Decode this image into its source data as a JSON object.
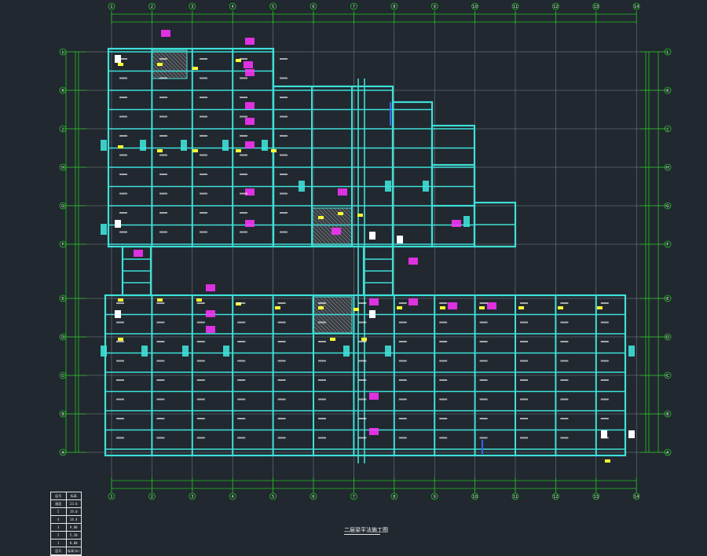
{
  "drawing": {
    "title": "二层梁平法施工图",
    "colors": {
      "background": "#212830",
      "grid_axis": "#22c41e",
      "beam": "#3ee0d8",
      "slab_label": "#ffffff",
      "annotation_magenta": "#ff33ff",
      "annotation_yellow": "#ffff33",
      "column": "#ffffff",
      "hatch": "#b0b0b0"
    },
    "column_axes": [
      "1",
      "2",
      "3",
      "4",
      "5",
      "6",
      "7",
      "8",
      "9",
      "10",
      "11",
      "12",
      "13",
      "14"
    ],
    "row_axes": [
      "A",
      "B",
      "C",
      "D",
      "E",
      "F",
      "G",
      "H",
      "J",
      "K",
      "L"
    ]
  },
  "legend": {
    "rows": [
      [
        "层号",
        "标高"
      ],
      [
        "屋面",
        "23.6"
      ],
      [
        "5",
        "19.0"
      ],
      [
        "4",
        "14.4"
      ],
      [
        "3",
        "9.80"
      ],
      [
        "2",
        "5.20"
      ],
      [
        "1",
        "0.00"
      ],
      [
        "层号",
        "标高(m)"
      ]
    ]
  }
}
